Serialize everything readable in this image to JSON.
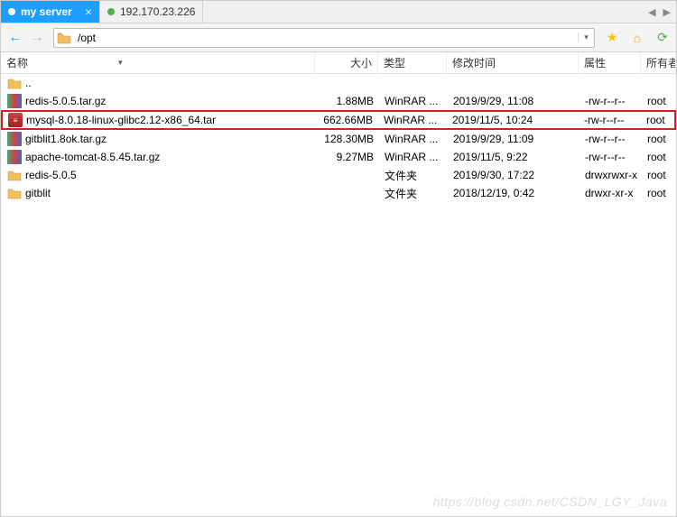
{
  "tabs": [
    {
      "label": "my server",
      "active": true
    },
    {
      "label": "192.170.23.226",
      "active": false
    }
  ],
  "address_path": "/opt",
  "columns": {
    "name": "名称",
    "size": "大小",
    "type": "类型",
    "date": "修改时间",
    "attr": "属性",
    "owner": "所有者"
  },
  "parent_dir_label": "..",
  "files": [
    {
      "icon": "archive-books",
      "name": "redis-5.0.5.tar.gz",
      "size": "1.88MB",
      "type": "WinRAR ...",
      "date": "2019/9/29, 11:08",
      "attr": "-rw-r--r--",
      "owner": "root",
      "highlighted": false
    },
    {
      "icon": "archive-red",
      "name": "mysql-8.0.18-linux-glibc2.12-x86_64.tar",
      "size": "662.66MB",
      "type": "WinRAR ...",
      "date": "2019/11/5, 10:24",
      "attr": "-rw-r--r--",
      "owner": "root",
      "highlighted": true
    },
    {
      "icon": "archive-books",
      "name": "gitblit1.8ok.tar.gz",
      "size": "128.30MB",
      "type": "WinRAR ...",
      "date": "2019/9/29, 11:09",
      "attr": "-rw-r--r--",
      "owner": "root",
      "highlighted": false
    },
    {
      "icon": "archive-books",
      "name": "apache-tomcat-8.5.45.tar.gz",
      "size": "9.27MB",
      "type": "WinRAR ...",
      "date": "2019/11/5, 9:22",
      "attr": "-rw-r--r--",
      "owner": "root",
      "highlighted": false
    },
    {
      "icon": "folder",
      "name": "redis-5.0.5",
      "size": "",
      "type": "文件夹",
      "date": "2019/9/30, 17:22",
      "attr": "drwxrwxr-x",
      "owner": "root",
      "highlighted": false
    },
    {
      "icon": "folder",
      "name": "gitblit",
      "size": "",
      "type": "文件夹",
      "date": "2018/12/19, 0:42",
      "attr": "drwxr-xr-x",
      "owner": "root",
      "highlighted": false
    }
  ],
  "watermark": "https://blog.csdn.net/CSDN_LGY_Java"
}
